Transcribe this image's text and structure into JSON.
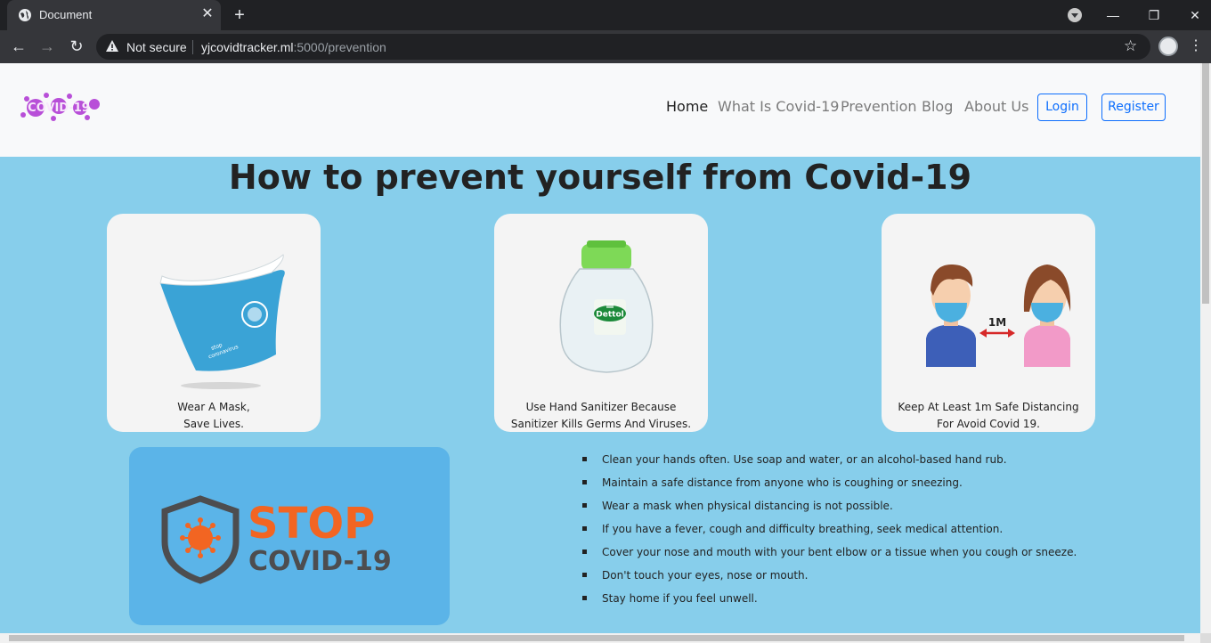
{
  "browser": {
    "tab_title": "Document",
    "security_label": "Not secure",
    "url_host": "yjcovidtracker.ml",
    "url_rest": ":5000/prevention"
  },
  "navbar": {
    "logo_text": "COVID-19",
    "links": [
      {
        "label": "Home",
        "active": true
      },
      {
        "label": "What Is Covid-19",
        "active": false
      },
      {
        "label": "Prevention",
        "active": false
      },
      {
        "label": "Blog",
        "active": false
      },
      {
        "label": "About Us",
        "active": false
      }
    ],
    "login_label": "Login",
    "register_label": "Register"
  },
  "page": {
    "title": "How to prevent yourself from Covid-19",
    "cards": [
      {
        "icon": "face-mask-image",
        "line1": "Wear A Mask,",
        "line2": "Save Lives."
      },
      {
        "icon": "hand-sanitizer-image",
        "line1": "Use Hand Sanitizer Because",
        "line2": "Sanitizer Kills Germs And Viruses."
      },
      {
        "icon": "social-distancing-image",
        "line1": "Keep At Least 1m Safe Distancing",
        "line2": "For Avoid Covid 19.",
        "distance_label": "1M",
        "bottle_brand": "Dettol"
      }
    ],
    "stop_banner": {
      "line1": "STOP",
      "line2": "COVID-19"
    },
    "tips": [
      "Clean your hands often. Use soap and water, or an alcohol-based hand rub.",
      "Maintain a safe distance from anyone who is coughing or sneezing.",
      "Wear a mask when physical distancing is not possible.",
      "If you have a fever, cough and difficulty breathing, seek medical attention.",
      "Cover your nose and mouth with your bent elbow or a tissue when you cough or sneeze.",
      "Don't touch your eyes, nose or mouth.",
      "Stay home if you feel unwell."
    ]
  },
  "colors": {
    "page_bg": "#87ceeb",
    "accent": "#0d6efd",
    "stop_orange": "#f26522",
    "stop_gray": "#4d4d4f"
  }
}
